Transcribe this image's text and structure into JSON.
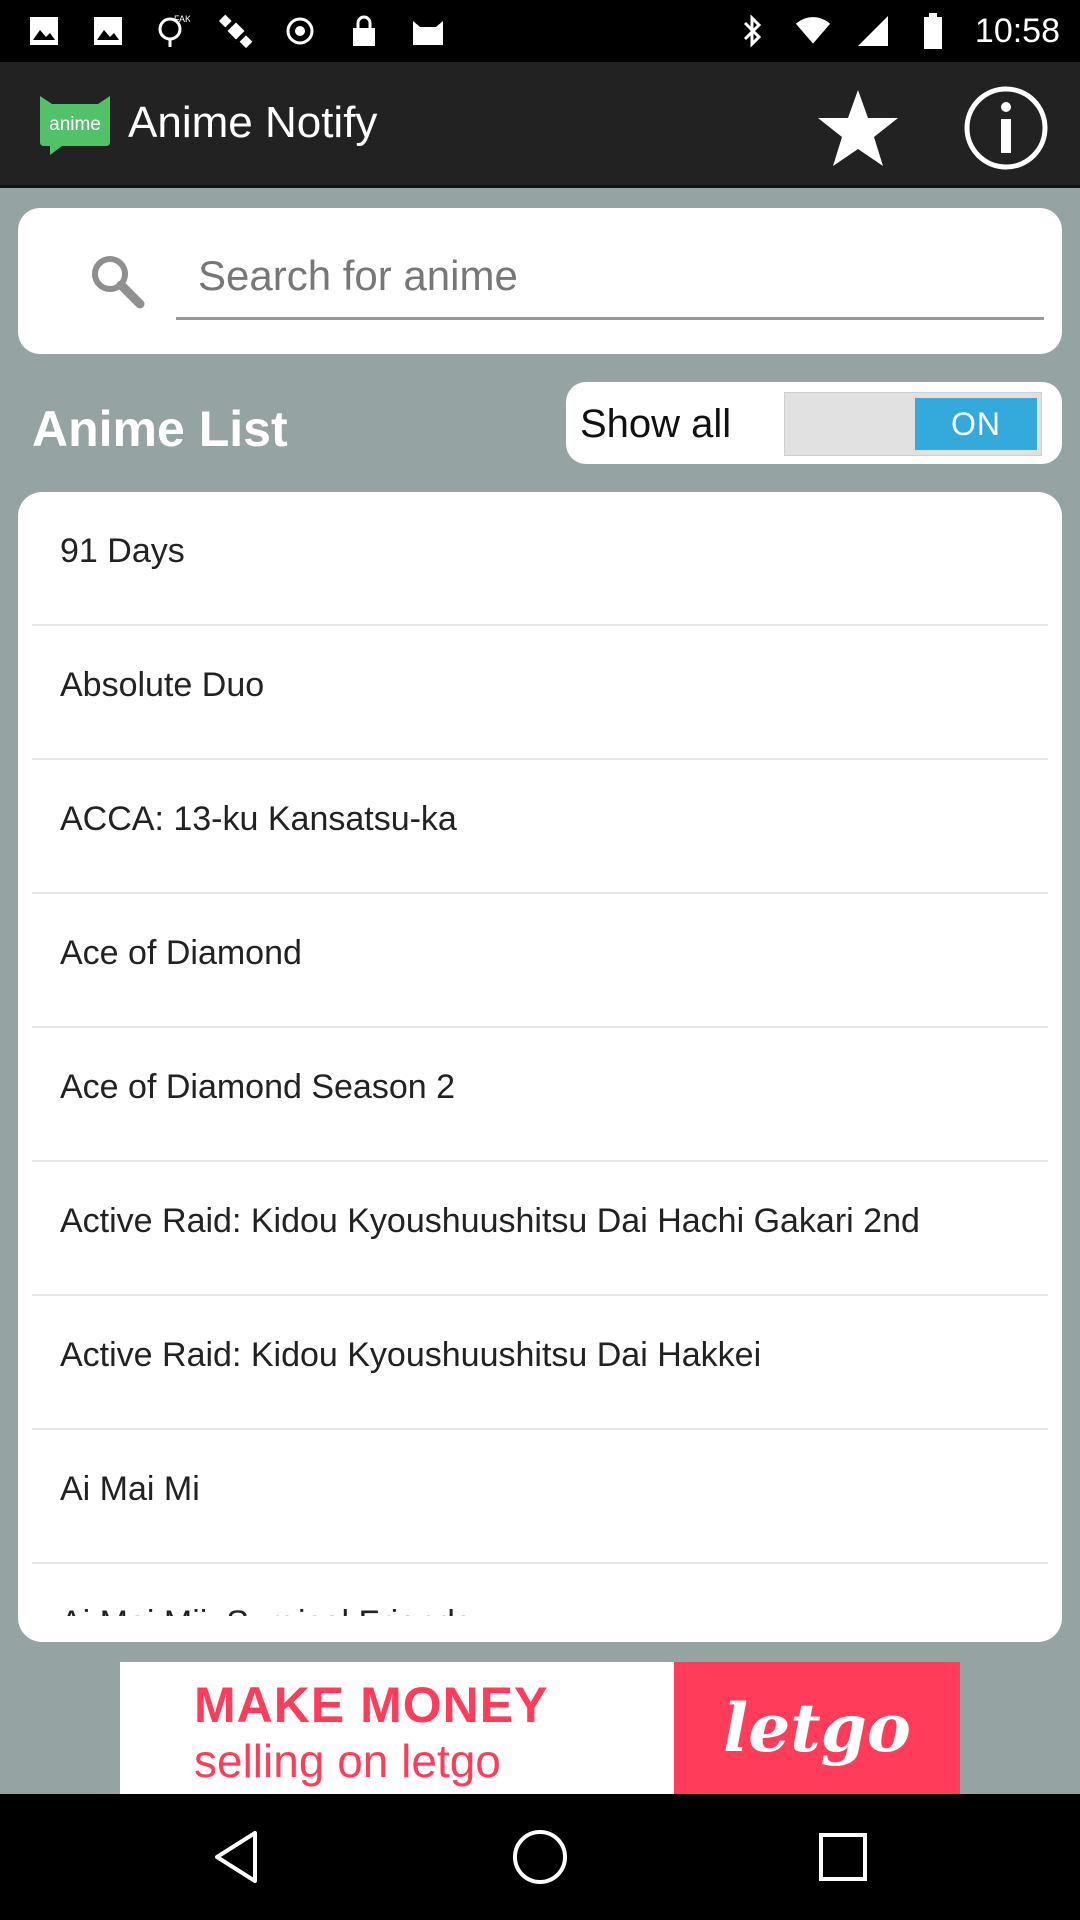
{
  "status_bar": {
    "time": "10:58",
    "left_icons": [
      "photo-icon",
      "photo-icon",
      "fake-gps-icon",
      "satellite-icon",
      "sync-icon",
      "lock-icon",
      "cat-icon"
    ],
    "right_icons": [
      "bluetooth-icon",
      "wifi-icon",
      "signal-icon",
      "battery-icon"
    ]
  },
  "app_bar": {
    "logo_text": "anime",
    "title": "Anime Notify",
    "favorites_icon": "star-icon",
    "info_icon": "info-icon"
  },
  "search": {
    "placeholder": "Search for anime",
    "value": ""
  },
  "list_section": {
    "heading": "Anime List",
    "show_all_label": "Show all",
    "toggle_state": "ON"
  },
  "anime_list": [
    "91 Days",
    "Absolute Duo",
    "ACCA: 13-ku Kansatsu-ka",
    "Ace of Diamond",
    "Ace of Diamond Season 2",
    "Active Raid: Kidou Kyoushuushitsu Dai Hachi Gakari 2nd",
    "Active Raid: Kidou Kyoushuushitsu Dai Hakkei",
    "Ai Mai Mi",
    "Ai Mai Mii: Surgical Friends"
  ],
  "ad": {
    "line1": "MAKE MONEY",
    "line2": "selling on letgo",
    "brand": "letgo"
  },
  "colors": {
    "background": "#95a4a3",
    "app_bar": "#222222",
    "logo_green": "#52c26a",
    "toggle_on": "#33a9dc",
    "ad_red": "#ff3d5a"
  },
  "nav_bar": {
    "buttons": [
      "back-icon",
      "home-icon",
      "recents-icon"
    ]
  }
}
